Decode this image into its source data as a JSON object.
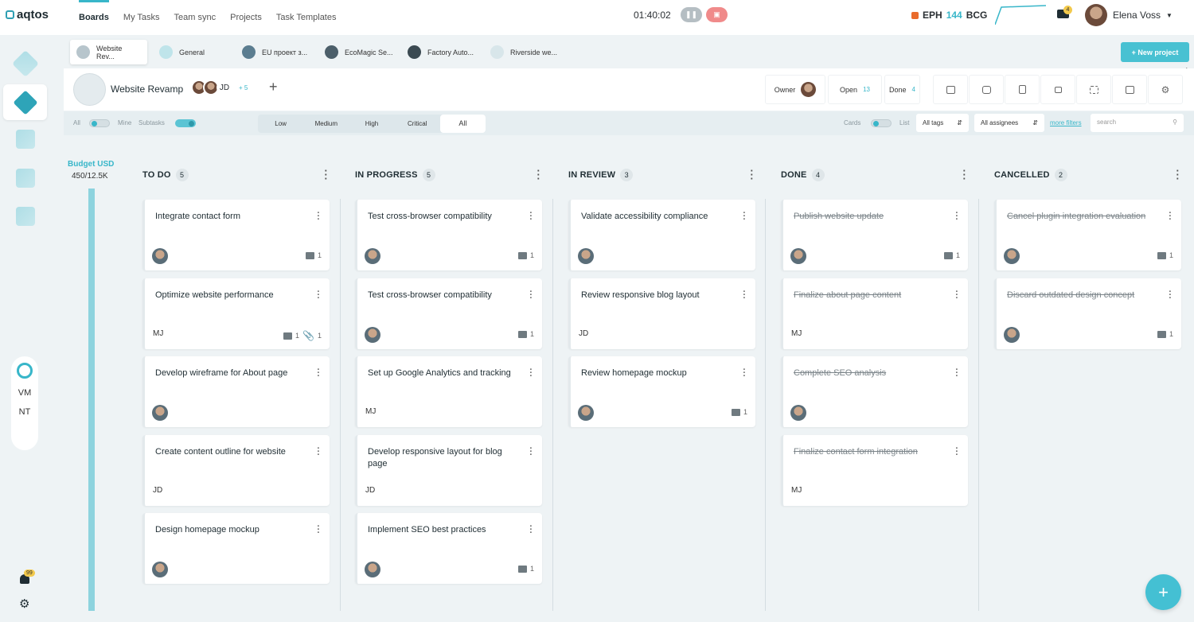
{
  "app": {
    "logo_text": "aqtos"
  },
  "nav": {
    "items": [
      "Boards",
      "My Tasks",
      "Team sync",
      "Projects",
      "Task Templates"
    ],
    "active": "Boards"
  },
  "timer": {
    "value": "01:40:02"
  },
  "stats": {
    "eph_label": "EPH",
    "eph_value": "144",
    "bcg_label": "BCG"
  },
  "notifications": {
    "mail_count": "4",
    "bell_count": "99"
  },
  "user": {
    "name": "Elena Voss"
  },
  "project_tabs": [
    {
      "label": "Website Rev..."
    },
    {
      "label": "General"
    },
    {
      "label": "EU проект з..."
    },
    {
      "label": "EcoMagic Se..."
    },
    {
      "label": "Factory Auto..."
    },
    {
      "label": "Riverside we..."
    }
  ],
  "new_project_label": "+ New project",
  "sidebar": {
    "avatars": [
      "VM",
      "NT"
    ]
  },
  "project": {
    "title": "Website Revamp",
    "team_initials": "JD",
    "team_more": "+ 5",
    "owner_label": "Owner",
    "open_label": "Open",
    "open_count": "13",
    "done_label": "Done",
    "done_count": "4",
    "toolbar_icons": [
      "archive-icon",
      "chat-icon",
      "document-icon",
      "lock-icon",
      "expand-icon",
      "export-icon",
      "settings-icon"
    ]
  },
  "filters": {
    "all_label": "All",
    "mine_label": "Mine",
    "subtasks_label": "Subtasks",
    "priorities": [
      "Low",
      "Medium",
      "High",
      "Critical",
      "All"
    ],
    "priority_selected": "All",
    "cards_label": "Cards",
    "list_label": "List",
    "tags_value": "All tags",
    "assignees_value": "All assignees",
    "more_filters": "more filters",
    "search_placeholder": "search"
  },
  "budget": {
    "label": "Budget USD",
    "value": "450/12.5K"
  },
  "columns": [
    {
      "title": "TO DO",
      "count": "5",
      "cards": [
        {
          "title": "Integrate contact form",
          "assignee": "avatar",
          "comments": "1"
        },
        {
          "title": "Optimize website performance",
          "assignee": "MJ",
          "comments": "1",
          "attachments": "1"
        },
        {
          "title": "Develop wireframe for About page",
          "assignee": "avatar"
        },
        {
          "title": "Create content outline for website",
          "assignee": "JD"
        },
        {
          "title": "Design homepage mockup",
          "assignee": "avatar"
        }
      ]
    },
    {
      "title": "IN PROGRESS",
      "count": "5",
      "cards": [
        {
          "title": "Test cross-browser compatibility",
          "assignee": "avatar",
          "comments": "1"
        },
        {
          "title": "Test cross-browser compatibility",
          "assignee": "avatar",
          "comments": "1"
        },
        {
          "title": "Set up Google Analytics and tracking",
          "assignee": "MJ"
        },
        {
          "title": "Develop responsive layout for blog page",
          "assignee": "JD"
        },
        {
          "title": "Implement SEO best practices",
          "assignee": "avatar",
          "comments": "1"
        }
      ]
    },
    {
      "title": "IN REVIEW",
      "count": "3",
      "cards": [
        {
          "title": "Validate accessibility compliance",
          "assignee": "avatar"
        },
        {
          "title": "Review responsive blog layout",
          "assignee": "JD"
        },
        {
          "title": "Review homepage mockup",
          "assignee": "avatar",
          "comments": "1"
        }
      ]
    },
    {
      "title": "DONE",
      "count": "4",
      "cards": [
        {
          "title": "Publish website update",
          "assignee": "avatar",
          "comments": "1"
        },
        {
          "title": "Finalize about page content",
          "assignee": "MJ"
        },
        {
          "title": "Complete SEO analysis",
          "assignee": "avatar"
        },
        {
          "title": "Finalize contact form integration",
          "assignee": "MJ"
        }
      ]
    },
    {
      "title": "CANCELLED",
      "count": "2",
      "cards": [
        {
          "title": "Cancel plugin integration evaluation",
          "assignee": "avatar",
          "comments": "1"
        },
        {
          "title": "Discard outdated design concept",
          "assignee": "avatar",
          "comments": "1"
        }
      ]
    }
  ],
  "colors": {
    "accent": "#38b6c9",
    "pause": "#b5bec3",
    "stop": "#f08a8a"
  }
}
